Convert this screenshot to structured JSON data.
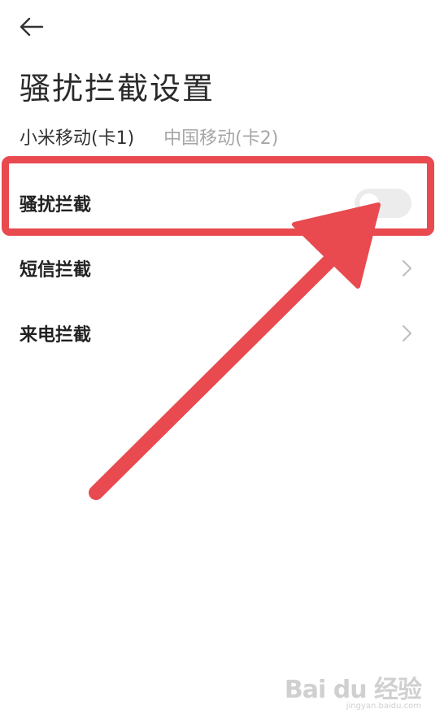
{
  "page": {
    "title": "骚扰拦截设置"
  },
  "tabs": [
    {
      "label": "小米移动(卡1)",
      "active": true
    },
    {
      "label": "中国移动(卡2)",
      "active": false
    }
  ],
  "rows": [
    {
      "label": "骚扰拦截",
      "control": "toggle",
      "enabled": false
    },
    {
      "label": "短信拦截",
      "control": "chevron"
    },
    {
      "label": "来电拦截",
      "control": "chevron"
    }
  ],
  "icons": {
    "back": "arrow-left-icon",
    "chevron": "chevron-right-icon"
  },
  "colors": {
    "annotation": "#e84a4f",
    "toggle_off": "#ececec",
    "text_inactive": "#a6a6a6"
  },
  "watermark": {
    "logo": "Bai du 经验",
    "url": "jingyan.baidu.com"
  }
}
